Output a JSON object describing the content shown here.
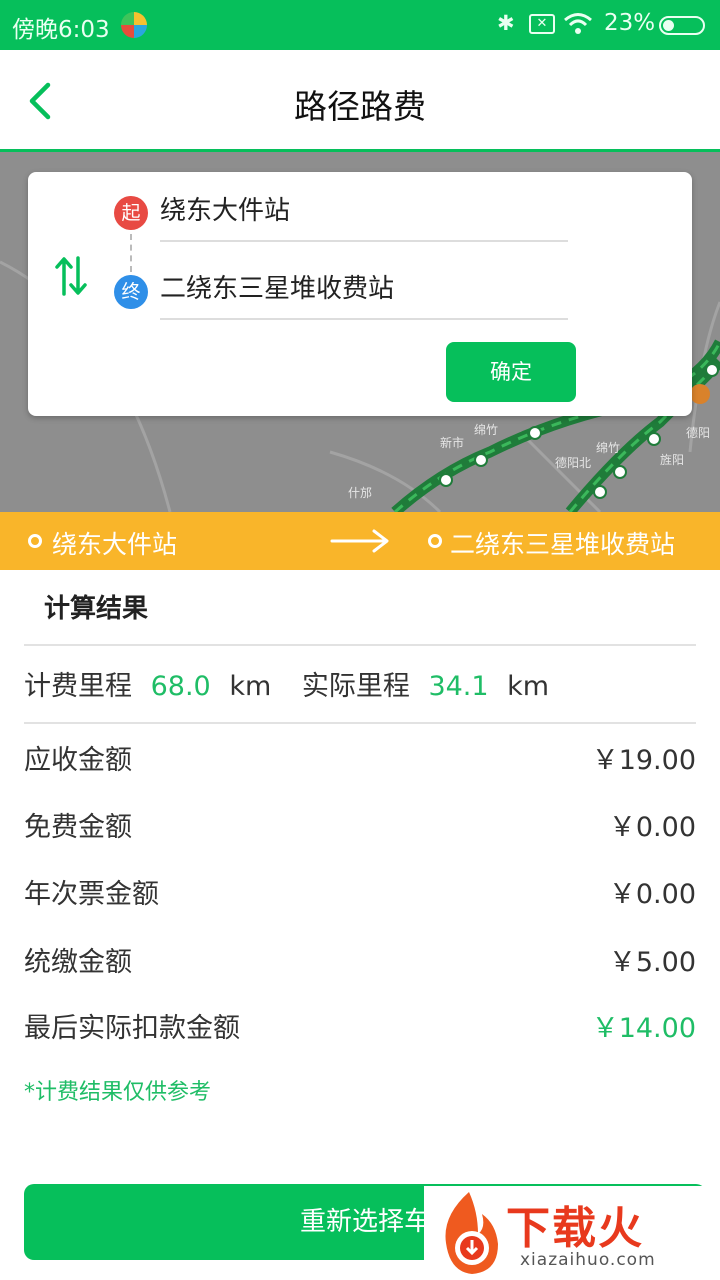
{
  "status_bar": {
    "time": "傍晚6:03",
    "bluetooth_icon": "bluetooth-icon",
    "sim_icon": "no-sim-icon",
    "wifi_icon": "wifi-icon",
    "battery_percent": "23%",
    "battery_level": 0.23
  },
  "header": {
    "back_icon": "back-chevron-icon",
    "title": "路径路费"
  },
  "route_card": {
    "start_badge": "起",
    "end_badge": "终",
    "start_station": "绕东大件站",
    "end_station": "二绕东三星堆收费站",
    "swap_icon": "swap-icon",
    "confirm_label": "确定"
  },
  "route_bar": {
    "from": "绕东大件站",
    "to": "二绕东三星堆收费站",
    "arrow_icon": "arrow-right-icon"
  },
  "results": {
    "title": "计算结果",
    "billing_mileage_label": "计费里程",
    "billing_mileage_value": "68.0",
    "actual_mileage_label": "实际里程",
    "actual_mileage_value": "34.1",
    "unit": "km",
    "rows": [
      {
        "label": "应收金额",
        "value": "￥19.00"
      },
      {
        "label": "免费金额",
        "value": "￥0.00"
      },
      {
        "label": "年次票金额",
        "value": "￥0.00"
      },
      {
        "label": "统缴金额",
        "value": "￥5.00"
      },
      {
        "label": "最后实际扣款金额",
        "value": "￥14.00"
      }
    ],
    "note": "*计费结果仅供参考"
  },
  "reselect_button": "重新选择车",
  "map_labels": [
    "新市",
    "绵竹",
    "什邡",
    "德阳北",
    "旌阳",
    "德阳",
    "绵竹"
  ],
  "watermark": {
    "brand": "下载火",
    "domain": "xiazaihuo.com"
  },
  "colors": {
    "primary_green": "#06bf5b",
    "value_green": "#1fbd66",
    "route_bar_orange": "#f9b52a",
    "start_red": "#e84a43",
    "end_blue": "#2f8fe8"
  }
}
